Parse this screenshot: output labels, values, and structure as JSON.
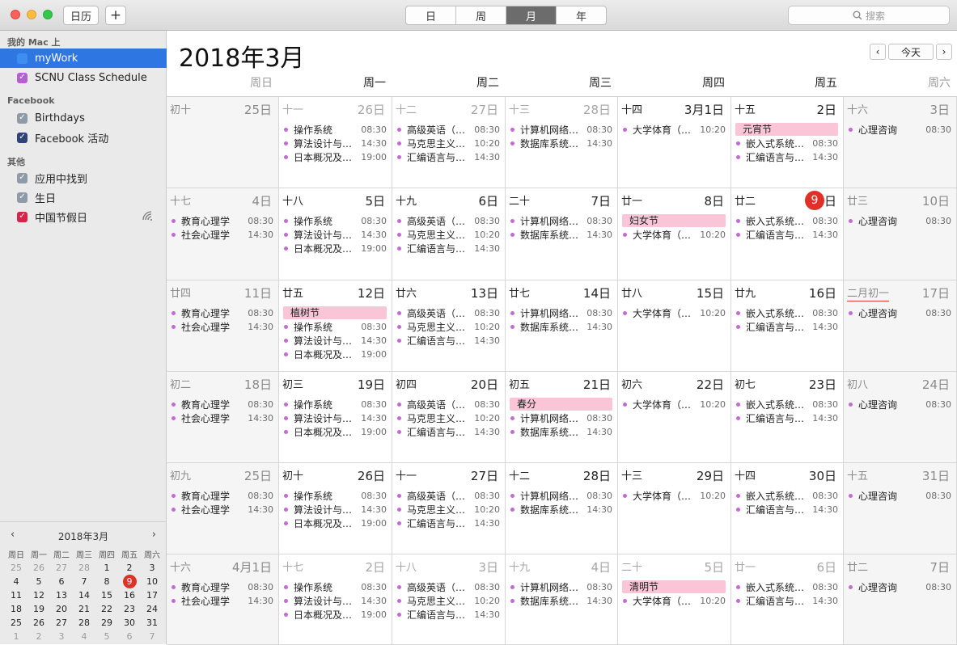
{
  "toolbar": {
    "calendars_btn": "日历",
    "add_btn": "+",
    "views": [
      "日",
      "周",
      "月",
      "年"
    ],
    "active_view": 2,
    "search_placeholder": "搜索"
  },
  "sidebar": {
    "groups": [
      {
        "title": "我的 Mac 上",
        "items": [
          {
            "label": "myWork",
            "color": "#3e8ef0",
            "selected": true,
            "checked": false
          },
          {
            "label": "SCNU Class Schedule",
            "color": "#b65fd1",
            "checked": true
          }
        ]
      },
      {
        "title": "Facebook",
        "items": [
          {
            "label": "Birthdays",
            "color": "#8e9aa8",
            "checked": true
          },
          {
            "label": "Facebook 活动",
            "color": "#2f4377",
            "checked": true
          }
        ]
      },
      {
        "title": "其他",
        "items": [
          {
            "label": "应用中找到",
            "color": "#8e9aa8",
            "checked": true
          },
          {
            "label": "生日",
            "color": "#8e9aa8",
            "checked": true
          },
          {
            "label": "中国节假日",
            "color": "#d8234a",
            "checked": true,
            "wifi": true
          }
        ]
      }
    ]
  },
  "mini_calendar": {
    "title": "2018年3月",
    "weekdays": [
      "周日",
      "周一",
      "周二",
      "周三",
      "周四",
      "周五",
      "周六"
    ],
    "days": [
      "25",
      "26",
      "27",
      "28",
      "1",
      "2",
      "3",
      "4",
      "5",
      "6",
      "7",
      "8",
      "9",
      "10",
      "11",
      "12",
      "13",
      "14",
      "15",
      "16",
      "17",
      "18",
      "19",
      "20",
      "21",
      "22",
      "23",
      "24",
      "25",
      "26",
      "27",
      "28",
      "29",
      "30",
      "31",
      "1",
      "2",
      "3",
      "4",
      "5",
      "6",
      "7"
    ],
    "today_index": 12
  },
  "main": {
    "title": "2018年3月",
    "today_btn": "今天",
    "weekdays": [
      "周日",
      "周一",
      "周二",
      "周三",
      "周四",
      "周五",
      "周六"
    ],
    "weeks": [
      [
        {
          "lunar": "初十",
          "date": "25日",
          "dim": true,
          "holiday": "",
          "events": []
        },
        {
          "lunar": "十一",
          "date": "26日",
          "dim": true,
          "holiday": "",
          "events": [
            {
              "name": "操作系统",
              "time": "08:30"
            },
            {
              "name": "算法设计与…",
              "time": "14:30"
            },
            {
              "name": "日本概况及…",
              "time": "19:00"
            }
          ]
        },
        {
          "lunar": "十二",
          "date": "27日",
          "dim": true,
          "holiday": "",
          "events": [
            {
              "name": "高级英语（…",
              "time": "08:30"
            },
            {
              "name": "马克思主义…",
              "time": "10:20"
            },
            {
              "name": "汇编语言与…",
              "time": "14:30"
            }
          ]
        },
        {
          "lunar": "十三",
          "date": "28日",
          "dim": true,
          "holiday": "",
          "events": [
            {
              "name": "计算机网络…",
              "time": "08:30"
            },
            {
              "name": "数据库系统…",
              "time": "14:30"
            }
          ]
        },
        {
          "lunar": "十四",
          "date": "3月1日",
          "holiday": "",
          "events": [
            {
              "name": "大学体育（…",
              "time": "10:20"
            }
          ]
        },
        {
          "lunar": "十五",
          "date": "2日",
          "holiday": "元宵节",
          "events": [
            {
              "name": "嵌入式系统…",
              "time": "08:30"
            },
            {
              "name": "汇编语言与…",
              "time": "14:30"
            }
          ]
        },
        {
          "lunar": "十六",
          "date": "3日",
          "holiday": "",
          "events": [
            {
              "name": "心理咨询",
              "time": "08:30"
            }
          ]
        }
      ],
      [
        {
          "lunar": "十七",
          "date": "4日",
          "holiday": "",
          "events": [
            {
              "name": "教育心理学",
              "time": "08:30"
            },
            {
              "name": "社会心理学",
              "time": "14:30"
            }
          ]
        },
        {
          "lunar": "十八",
          "date": "5日",
          "holiday": "",
          "events": [
            {
              "name": "操作系统",
              "time": "08:30"
            },
            {
              "name": "算法设计与…",
              "time": "14:30"
            },
            {
              "name": "日本概况及…",
              "time": "19:00"
            }
          ]
        },
        {
          "lunar": "十九",
          "date": "6日",
          "holiday": "",
          "events": [
            {
              "name": "高级英语（…",
              "time": "08:30"
            },
            {
              "name": "马克思主义…",
              "time": "10:20"
            },
            {
              "name": "汇编语言与…",
              "time": "14:30"
            }
          ]
        },
        {
          "lunar": "二十",
          "date": "7日",
          "holiday": "",
          "events": [
            {
              "name": "计算机网络…",
              "time": "08:30"
            },
            {
              "name": "数据库系统…",
              "time": "14:30"
            }
          ]
        },
        {
          "lunar": "廿一",
          "date": "8日",
          "holiday": "妇女节",
          "events": [
            {
              "name": "大学体育（…",
              "time": "10:20"
            }
          ]
        },
        {
          "lunar": "廿二",
          "date": "9日",
          "today": true,
          "today_num": "9",
          "today_suffix": "日",
          "holiday": "",
          "events": [
            {
              "name": "嵌入式系统…",
              "time": "08:30"
            },
            {
              "name": "汇编语言与…",
              "time": "14:30"
            }
          ]
        },
        {
          "lunar": "廿三",
          "date": "10日",
          "holiday": "",
          "events": [
            {
              "name": "心理咨询",
              "time": "08:30"
            }
          ]
        }
      ],
      [
        {
          "lunar": "廿四",
          "date": "11日",
          "holiday": "",
          "events": [
            {
              "name": "教育心理学",
              "time": "08:30"
            },
            {
              "name": "社会心理学",
              "time": "14:30"
            }
          ]
        },
        {
          "lunar": "廿五",
          "date": "12日",
          "holiday": "植树节",
          "events": [
            {
              "name": "操作系统",
              "time": "08:30"
            },
            {
              "name": "算法设计与…",
              "time": "14:30"
            },
            {
              "name": "日本概况及…",
              "time": "19:00"
            }
          ]
        },
        {
          "lunar": "廿六",
          "date": "13日",
          "holiday": "",
          "events": [
            {
              "name": "高级英语（…",
              "time": "08:30"
            },
            {
              "name": "马克思主义…",
              "time": "10:20"
            },
            {
              "name": "汇编语言与…",
              "time": "14:30"
            }
          ]
        },
        {
          "lunar": "廿七",
          "date": "14日",
          "holiday": "",
          "events": [
            {
              "name": "计算机网络…",
              "time": "08:30"
            },
            {
              "name": "数据库系统…",
              "time": "14:30"
            }
          ]
        },
        {
          "lunar": "廿八",
          "date": "15日",
          "holiday": "",
          "events": [
            {
              "name": "大学体育（…",
              "time": "10:20"
            }
          ]
        },
        {
          "lunar": "廿九",
          "date": "16日",
          "holiday": "",
          "events": [
            {
              "name": "嵌入式系统…",
              "time": "08:30"
            },
            {
              "name": "汇编语言与…",
              "time": "14:30"
            }
          ]
        },
        {
          "lunar": "二月初一",
          "date": "17日",
          "lunar_highlight": true,
          "holiday": "",
          "events": [
            {
              "name": "心理咨询",
              "time": "08:30"
            }
          ]
        }
      ],
      [
        {
          "lunar": "初二",
          "date": "18日",
          "holiday": "",
          "events": [
            {
              "name": "教育心理学",
              "time": "08:30"
            },
            {
              "name": "社会心理学",
              "time": "14:30"
            }
          ]
        },
        {
          "lunar": "初三",
          "date": "19日",
          "holiday": "",
          "events": [
            {
              "name": "操作系统",
              "time": "08:30"
            },
            {
              "name": "算法设计与…",
              "time": "14:30"
            },
            {
              "name": "日本概况及…",
              "time": "19:00"
            }
          ]
        },
        {
          "lunar": "初四",
          "date": "20日",
          "holiday": "",
          "events": [
            {
              "name": "高级英语（…",
              "time": "08:30"
            },
            {
              "name": "马克思主义…",
              "time": "10:20"
            },
            {
              "name": "汇编语言与…",
              "time": "14:30"
            }
          ]
        },
        {
          "lunar": "初五",
          "date": "21日",
          "holiday": "春分",
          "events": [
            {
              "name": "计算机网络…",
              "time": "08:30"
            },
            {
              "name": "数据库系统…",
              "time": "14:30"
            }
          ]
        },
        {
          "lunar": "初六",
          "date": "22日",
          "holiday": "",
          "events": [
            {
              "name": "大学体育（…",
              "time": "10:20"
            }
          ]
        },
        {
          "lunar": "初七",
          "date": "23日",
          "holiday": "",
          "events": [
            {
              "name": "嵌入式系统…",
              "time": "08:30"
            },
            {
              "name": "汇编语言与…",
              "time": "14:30"
            }
          ]
        },
        {
          "lunar": "初八",
          "date": "24日",
          "holiday": "",
          "events": [
            {
              "name": "心理咨询",
              "time": "08:30"
            }
          ]
        }
      ],
      [
        {
          "lunar": "初九",
          "date": "25日",
          "holiday": "",
          "events": [
            {
              "name": "教育心理学",
              "time": "08:30"
            },
            {
              "name": "社会心理学",
              "time": "14:30"
            }
          ]
        },
        {
          "lunar": "初十",
          "date": "26日",
          "holiday": "",
          "events": [
            {
              "name": "操作系统",
              "time": "08:30"
            },
            {
              "name": "算法设计与…",
              "time": "14:30"
            },
            {
              "name": "日本概况及…",
              "time": "19:00"
            }
          ]
        },
        {
          "lunar": "十一",
          "date": "27日",
          "holiday": "",
          "events": [
            {
              "name": "高级英语（…",
              "time": "08:30"
            },
            {
              "name": "马克思主义…",
              "time": "10:20"
            },
            {
              "name": "汇编语言与…",
              "time": "14:30"
            }
          ]
        },
        {
          "lunar": "十二",
          "date": "28日",
          "holiday": "",
          "events": [
            {
              "name": "计算机网络…",
              "time": "08:30"
            },
            {
              "name": "数据库系统…",
              "time": "14:30"
            }
          ]
        },
        {
          "lunar": "十三",
          "date": "29日",
          "holiday": "",
          "events": [
            {
              "name": "大学体育（…",
              "time": "10:20"
            }
          ]
        },
        {
          "lunar": "十四",
          "date": "30日",
          "holiday": "",
          "events": [
            {
              "name": "嵌入式系统…",
              "time": "08:30"
            },
            {
              "name": "汇编语言与…",
              "time": "14:30"
            }
          ]
        },
        {
          "lunar": "十五",
          "date": "31日",
          "holiday": "",
          "events": [
            {
              "name": "心理咨询",
              "time": "08:30"
            }
          ]
        }
      ],
      [
        {
          "lunar": "十六",
          "date": "4月1日",
          "dim": true,
          "holiday": "",
          "events": [
            {
              "name": "教育心理学",
              "time": "08:30"
            },
            {
              "name": "社会心理学",
              "time": "14:30"
            }
          ]
        },
        {
          "lunar": "十七",
          "date": "2日",
          "dim": true,
          "holiday": "",
          "events": [
            {
              "name": "操作系统",
              "time": "08:30"
            },
            {
              "name": "算法设计与…",
              "time": "14:30"
            },
            {
              "name": "日本概况及…",
              "time": "19:00"
            }
          ]
        },
        {
          "lunar": "十八",
          "date": "3日",
          "dim": true,
          "holiday": "",
          "events": [
            {
              "name": "高级英语（…",
              "time": "08:30"
            },
            {
              "name": "马克思主义…",
              "time": "10:20"
            },
            {
              "name": "汇编语言与…",
              "time": "14:30"
            }
          ]
        },
        {
          "lunar": "十九",
          "date": "4日",
          "dim": true,
          "holiday": "",
          "events": [
            {
              "name": "计算机网络…",
              "time": "08:30"
            },
            {
              "name": "数据库系统…",
              "time": "14:30"
            }
          ]
        },
        {
          "lunar": "二十",
          "date": "5日",
          "dim": true,
          "holiday": "清明节",
          "events": [
            {
              "name": "大学体育（…",
              "time": "10:20"
            }
          ]
        },
        {
          "lunar": "廿一",
          "date": "6日",
          "dim": true,
          "holiday": "",
          "events": [
            {
              "name": "嵌入式系统…",
              "time": "08:30"
            },
            {
              "name": "汇编语言与…",
              "time": "14:30"
            }
          ]
        },
        {
          "lunar": "廿二",
          "date": "7日",
          "dim": true,
          "holiday": "",
          "events": [
            {
              "name": "心理咨询",
              "time": "08:30"
            }
          ]
        }
      ]
    ]
  }
}
